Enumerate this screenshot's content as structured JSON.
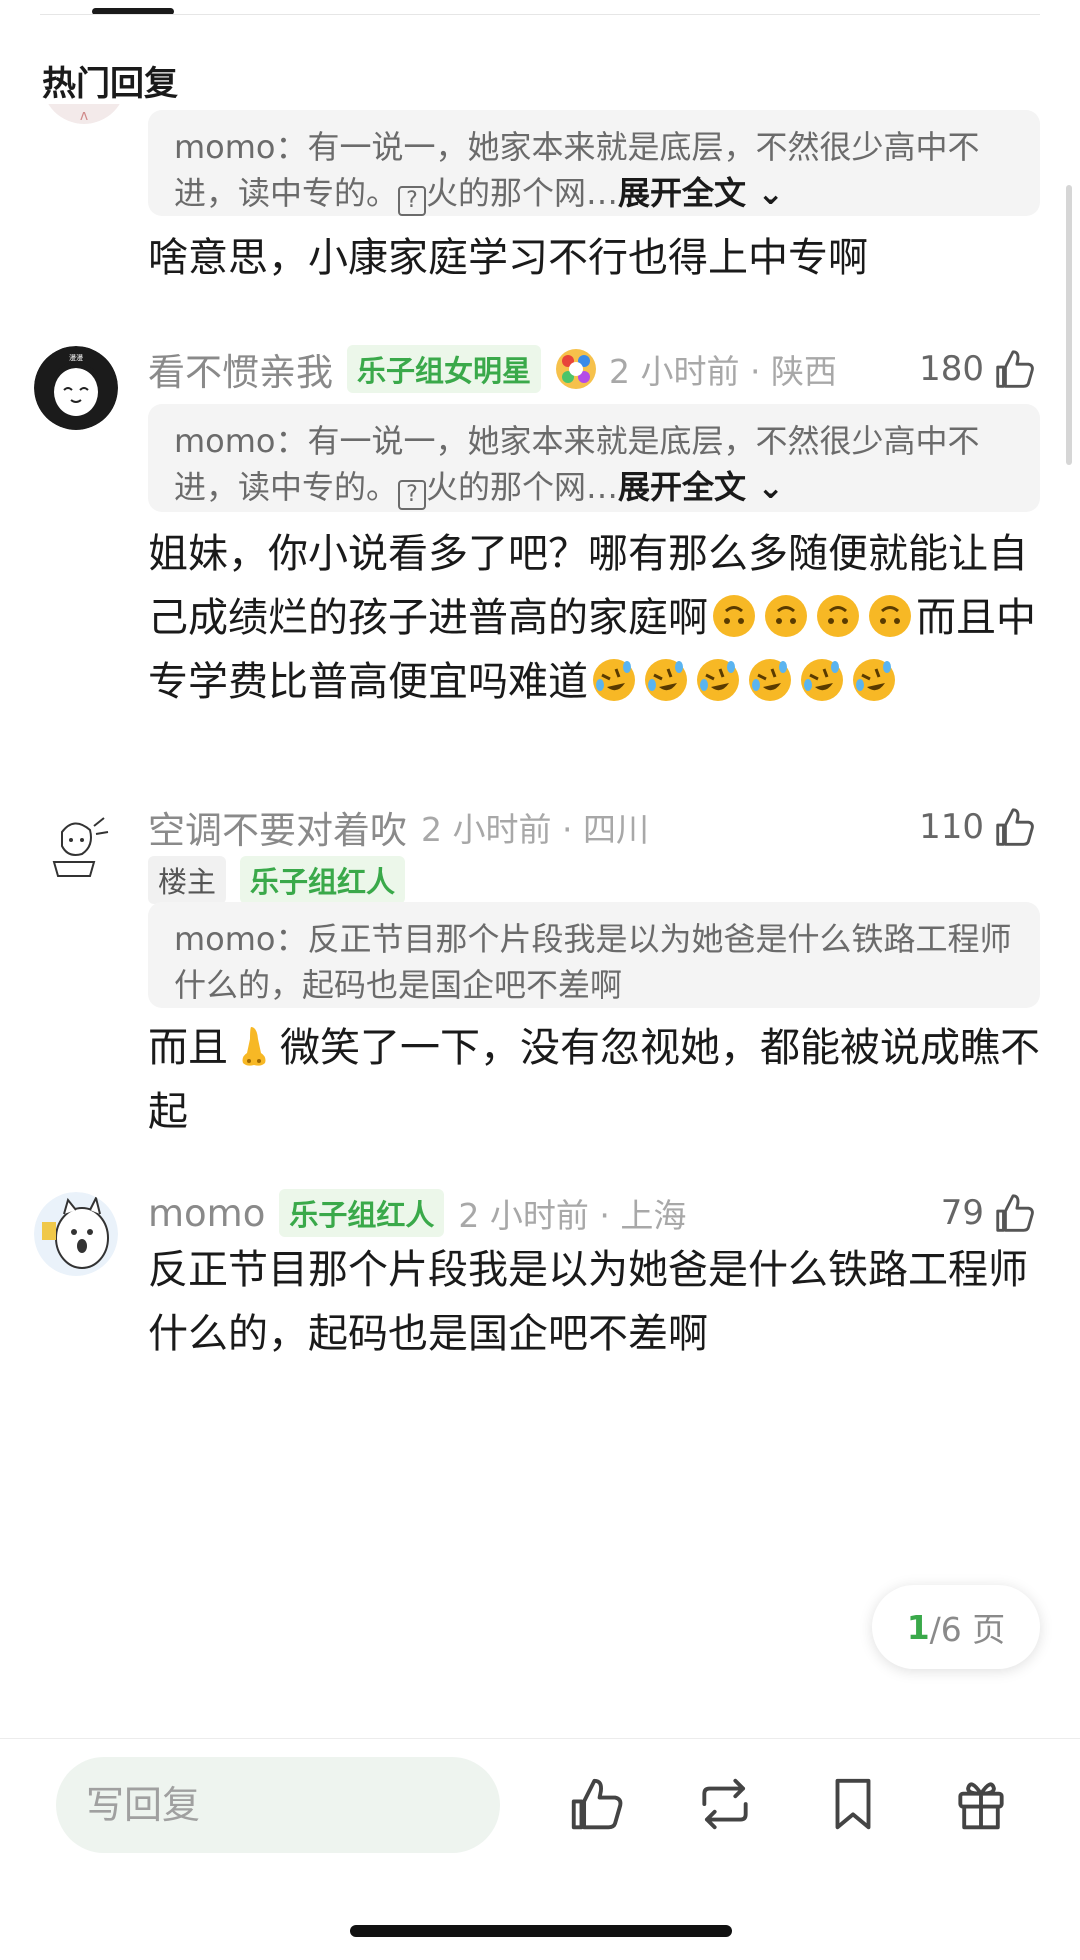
{
  "header": {
    "title": "热门回复"
  },
  "comments": [
    {
      "quote": {
        "name": "momo",
        "sep": "：",
        "text1": "有一说一，她家本来就是底层，不然很少高中不进，读中专的。",
        "icon": "?",
        "text2": "火的那个网…",
        "expand": "展开全文"
      },
      "body": "啥意思，小康家庭学习不行也得上中专啊"
    },
    {
      "username": "看不惯亲我",
      "badge": "乐子组女明星",
      "time_loc": "2 小时前 · 陕西",
      "likes": "180",
      "quote": {
        "name": "momo",
        "sep": "：",
        "text1": "有一说一，她家本来就是底层，不然很少高中不进，读中专的。",
        "icon": "?",
        "text2": "火的那个网…",
        "expand": "展开全文"
      },
      "body1": "姐妹，你小说看多了吧？哪有那么多随便就能让自己成绩烂的孩子进普高的家庭啊",
      "body2": "而且中专学费比普高便宜吗难道"
    },
    {
      "username": "空调不要对着吹",
      "time_loc": "2 小时前 · 四川",
      "likes": "110",
      "badge_host": "楼主",
      "badge": "乐子组红人",
      "quote": {
        "name": "momo",
        "sep": "：",
        "text": "反正节目那个片段我是以为她爸是什么铁路工程师什么的，起码也是国企吧不差啊"
      },
      "body1": "而且",
      "body2": "微笑了一下，没有忽视她，都能被说成瞧不起"
    },
    {
      "username": "momo",
      "badge": "乐子组红人",
      "time_loc": "2 小时前 · 上海",
      "likes": "79",
      "body": "反正节目那个片段我是以为她爸是什么铁路工程师什么的，起码也是国企吧不差啊"
    }
  ],
  "pager": {
    "current": "1",
    "total": "/6 页"
  },
  "footer": {
    "placeholder": "写回复"
  },
  "colors": {
    "accent_green": "#3aa94a",
    "badge_bg": "#ecf7ea",
    "quote_bg": "#f4f4f4",
    "meta_gray": "#a8a8a8"
  },
  "icons": [
    "thumb-up-icon",
    "repost-icon",
    "bookmark-icon",
    "gift-icon",
    "upside-down-face-emoji",
    "rolling-laughing-emoji",
    "nose-emoji"
  ]
}
